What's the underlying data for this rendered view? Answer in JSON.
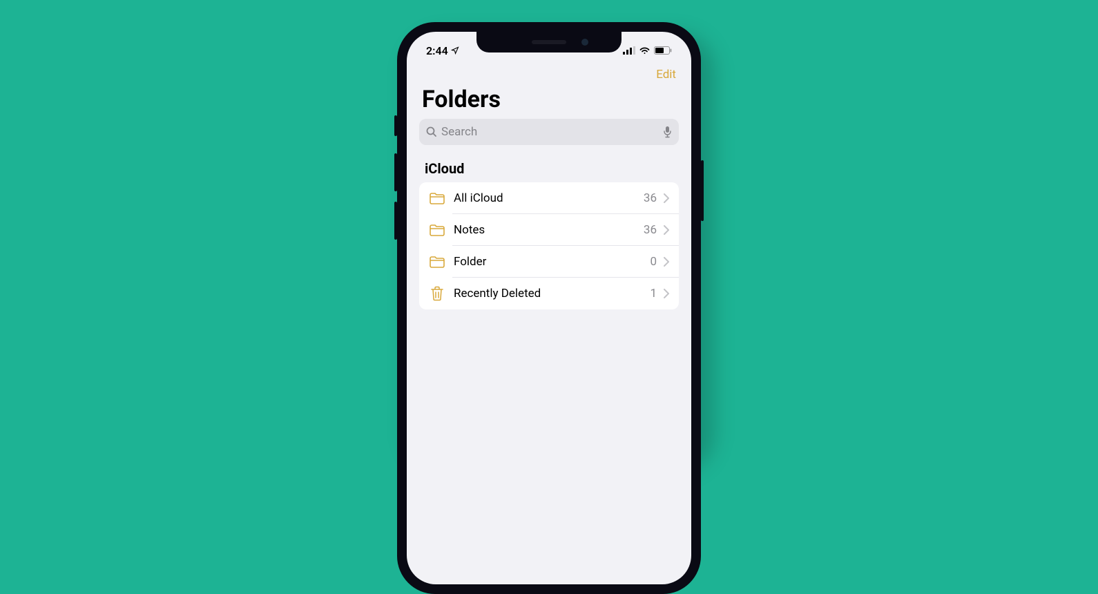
{
  "statusBar": {
    "time": "2:44"
  },
  "nav": {
    "editLabel": "Edit"
  },
  "page": {
    "title": "Folders"
  },
  "search": {
    "placeholder": "Search"
  },
  "section": {
    "header": "iCloud",
    "folders": [
      {
        "name": "All iCloud",
        "count": "36",
        "icon": "folder"
      },
      {
        "name": "Notes",
        "count": "36",
        "icon": "folder"
      },
      {
        "name": "Folder",
        "count": "0",
        "icon": "folder"
      },
      {
        "name": "Recently Deleted",
        "count": "1",
        "icon": "trash"
      }
    ]
  }
}
